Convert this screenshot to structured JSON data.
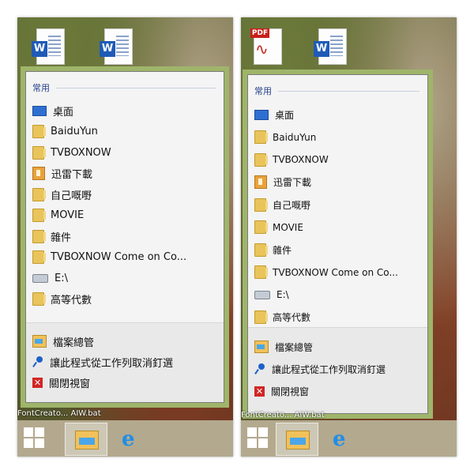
{
  "panels": [
    {
      "desktop_text": "FontCreato...   AIW.bat",
      "section_title": "常用",
      "items": [
        {
          "label": "桌面",
          "icon": "desktop-icon"
        },
        {
          "label": "BaiduYun",
          "icon": "folder-icon"
        },
        {
          "label": "TVBOXNOW",
          "icon": "folder-icon"
        },
        {
          "label": "迅雷下載",
          "icon": "thunder-icon"
        },
        {
          "label": "自己嘅嘢",
          "icon": "folder-icon"
        },
        {
          "label": "MOVIE",
          "icon": "folder-icon"
        },
        {
          "label": "雜件",
          "icon": "folder-icon"
        },
        {
          "label": "TVBOXNOW Come on Co...",
          "icon": "folder-icon"
        },
        {
          "label": "E:\\",
          "icon": "drive-icon"
        },
        {
          "label": "高等代數",
          "icon": "folder-icon"
        }
      ],
      "tasks": [
        {
          "label": "檔案總管",
          "icon": "file-explorer-icon"
        },
        {
          "label": "讓此程式從工作列取消釘選",
          "icon": "unpin-icon"
        },
        {
          "label": "關閉視窗",
          "icon": "close-icon"
        }
      ]
    },
    {
      "desktop_text": "FontCreato...   AIW.bat",
      "section_title": "常用",
      "items": [
        {
          "label": "桌面",
          "icon": "desktop-icon"
        },
        {
          "label": "BaiduYun",
          "icon": "folder-icon"
        },
        {
          "label": "TVBOXNOW",
          "icon": "folder-icon"
        },
        {
          "label": "迅雷下載",
          "icon": "thunder-icon"
        },
        {
          "label": "自己嘅嘢",
          "icon": "folder-icon"
        },
        {
          "label": "MOVIE",
          "icon": "folder-icon"
        },
        {
          "label": "雜件",
          "icon": "folder-icon"
        },
        {
          "label": "TVBOXNOW Come on Co...",
          "icon": "folder-icon"
        },
        {
          "label": "E:\\",
          "icon": "drive-icon"
        },
        {
          "label": "高等代數",
          "icon": "folder-icon"
        }
      ],
      "tasks": [
        {
          "label": "檔案總管",
          "icon": "file-explorer-icon"
        },
        {
          "label": "讓此程式從工作列取消釘選",
          "icon": "unpin-icon"
        },
        {
          "label": "關閉視窗",
          "icon": "close-icon"
        }
      ]
    }
  ],
  "desktop_icons": {
    "word_badge": "W",
    "pdf_badge": "PDF"
  },
  "colors": {
    "accent_border": "#9fb56a",
    "taskbar": "#b3a98e",
    "windows_logo": "#ffffff",
    "ie_blue": "#1f8ee6"
  }
}
